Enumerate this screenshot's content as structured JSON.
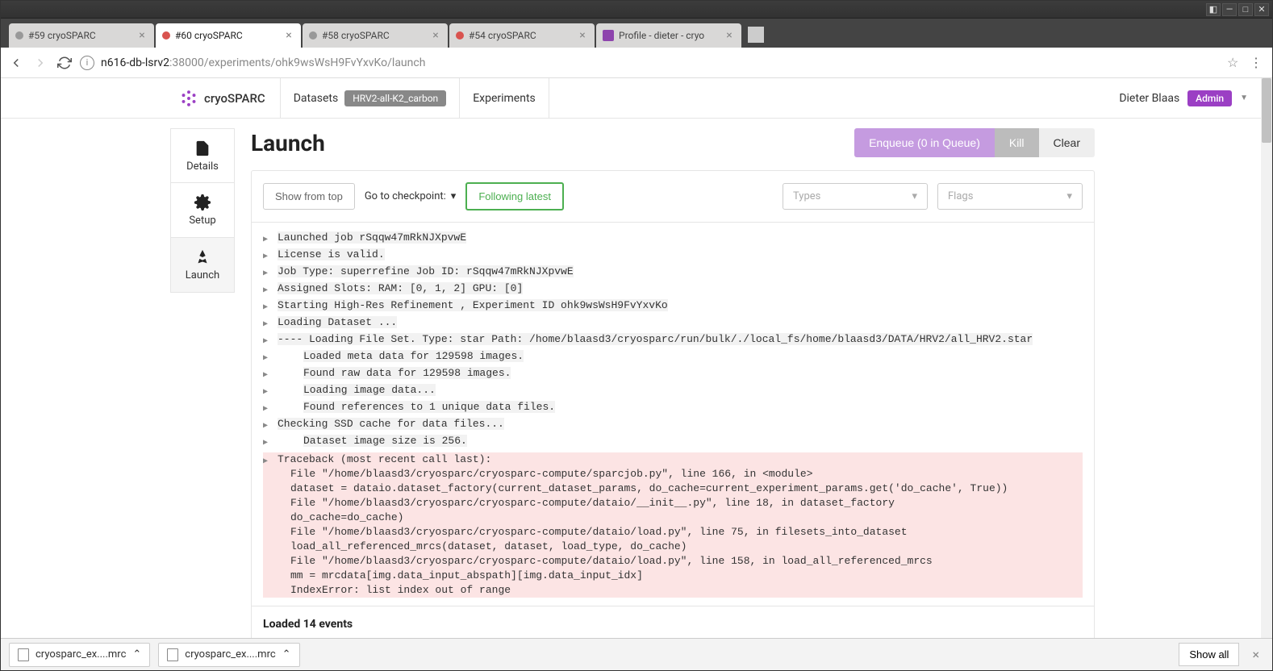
{
  "window": {
    "tabs": [
      {
        "title": "#59 cryoSPARC",
        "dot": "gray",
        "active": false
      },
      {
        "title": "#60 cryoSPARC",
        "dot": "red",
        "active": true
      },
      {
        "title": "#58 cryoSPARC",
        "dot": "gray",
        "active": false
      },
      {
        "title": "#54 cryoSPARC",
        "dot": "red",
        "active": false
      },
      {
        "title": "Profile - dieter - cryo",
        "favicon": true,
        "active": false
      }
    ]
  },
  "url": {
    "host": "n616-db-lsrv2",
    "path": ":38000/experiments/ohk9wsWsH9FvYxvKo/launch"
  },
  "header": {
    "brand": "cryoSPARC",
    "nav_datasets": "Datasets",
    "dataset_badge": "HRV2-all-K2_carbon",
    "nav_experiments": "Experiments",
    "user_name": "Dieter Blaas",
    "admin_label": "Admin"
  },
  "sidebar": {
    "items": [
      {
        "label": "Details",
        "icon": "📄"
      },
      {
        "label": "Setup",
        "icon": "⚙"
      },
      {
        "label": "Launch",
        "icon": "🚀"
      }
    ]
  },
  "page": {
    "title": "Launch",
    "btn_enqueue": "Enqueue (0 in Queue)",
    "btn_kill": "Kill",
    "btn_clear": "Clear"
  },
  "controls": {
    "show_from_top": "Show from top",
    "goto_checkpoint": "Go to checkpoint:",
    "following_latest": "Following latest",
    "types_placeholder": "Types",
    "flags_placeholder": "Flags"
  },
  "log": {
    "lines": [
      {
        "arrow": true,
        "text": "Launched job rSqqw47mRkNJXpvwE",
        "hl": true
      },
      {
        "arrow": true,
        "text": "License is valid.",
        "hl": true
      },
      {
        "arrow": true,
        "text": "Job Type:  superrefine  Job ID:  rSqqw47mRkNJXpvwE",
        "hl": true
      },
      {
        "arrow": true,
        "text": "Assigned Slots: RAM:  [0, 1, 2]  GPU:  [0]",
        "hl": true
      },
      {
        "arrow": true,
        "text": "Starting  High-Res Refinement , Experiment ID  ohk9wsWsH9FvYxvKo",
        "hl": true
      },
      {
        "arrow": true,
        "text": "Loading Dataset ...",
        "hl": true
      },
      {
        "arrow": true,
        "text": "---- Loading File Set. Type: star Path: /home/blaasd3/cryosparc/run/bulk/./local_fs/home/blaasd3/DATA/HRV2/all_HRV2.star",
        "hl": true
      },
      {
        "arrow": true,
        "text": "Loaded meta data for 129598 images.",
        "hl": true,
        "indent": 1
      },
      {
        "arrow": true,
        "text": "Found raw data for 129598 images.",
        "hl": true,
        "indent": 1
      },
      {
        "arrow": true,
        "text": "Loading image data...",
        "hl": true,
        "indent": 1
      },
      {
        "arrow": true,
        "text": "Found references to 1 unique data files.",
        "hl": true,
        "indent": 1
      },
      {
        "arrow": true,
        "text": "Checking SSD cache for data files...",
        "hl": true
      },
      {
        "arrow": true,
        "text": "Dataset image size is 256.",
        "hl": true,
        "indent": 1
      }
    ],
    "error_first": "Traceback (most recent call last):",
    "error_body": [
      "  File \"/home/blaasd3/cryosparc/cryosparc-compute/sparcjob.py\", line 166, in <module>",
      "    dataset = dataio.dataset_factory(current_dataset_params, do_cache=current_experiment_params.get('do_cache', True))",
      "  File \"/home/blaasd3/cryosparc/cryosparc-compute/dataio/__init__.py\", line 18, in dataset_factory",
      "    do_cache=do_cache)",
      "  File \"/home/blaasd3/cryosparc/cryosparc-compute/dataio/load.py\", line 75, in filesets_into_dataset",
      "    load_all_referenced_mrcs(dataset, dataset, load_type, do_cache)",
      "  File \"/home/blaasd3/cryosparc/cryosparc-compute/dataio/load.py\", line 158, in load_all_referenced_mrcs",
      "    mm = mrcdata[img.data_input_abspath][img.data_input_idx]",
      "IndexError: list index out of range"
    ]
  },
  "footer": {
    "text": "Loaded 14 events"
  },
  "downloads": {
    "items": [
      "cryosparc_ex....mrc",
      "cryosparc_ex....mrc"
    ],
    "show_all": "Show all"
  }
}
